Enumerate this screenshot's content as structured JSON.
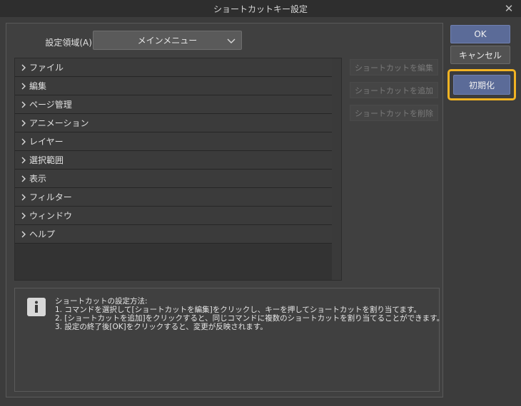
{
  "window": {
    "title": "ショートカットキー設定",
    "close_glyph": "✕"
  },
  "settings_area": {
    "label": "設定領域(A):",
    "selected": "メインメニュー"
  },
  "tree_items": [
    {
      "label": "ファイル"
    },
    {
      "label": "編集"
    },
    {
      "label": "ページ管理"
    },
    {
      "label": "アニメーション"
    },
    {
      "label": "レイヤー"
    },
    {
      "label": "選択範囲"
    },
    {
      "label": "表示"
    },
    {
      "label": "フィルター"
    },
    {
      "label": "ウィンドウ"
    },
    {
      "label": "ヘルプ"
    }
  ],
  "side_buttons": {
    "edit": "ショートカットを編集",
    "add": "ショートカットを追加",
    "delete": "ショートカットを削除"
  },
  "info": {
    "icon": "info-icon",
    "lines": [
      "ショートカットの設定方法:",
      "1. コマンドを選択して[ショートカットを編集]をクリックし、キーを押してショートカットを割り当てます。",
      "2. [ショートカットを追加]をクリックすると、同じコマンドに複数のショートカットを割り当てることができます。",
      "3. 設定の終了後[OK]をクリックすると、変更が反映されます。"
    ]
  },
  "dialog_buttons": {
    "ok": "OK",
    "cancel": "キャンセル",
    "reset": "初期化"
  },
  "colors": {
    "accent": "#5b6b98",
    "highlight": "#f2b323"
  }
}
